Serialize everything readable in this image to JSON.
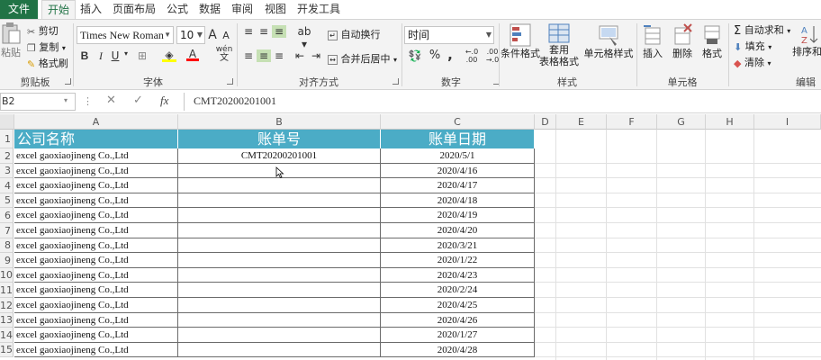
{
  "tabs": [
    "文件",
    "开始",
    "插入",
    "页面布局",
    "公式",
    "数据",
    "审阅",
    "视图",
    "开发工具"
  ],
  "clipboard": {
    "paste": "粘贴",
    "cut": "剪切",
    "copy": "复制",
    "format_painter": "格式刷",
    "label": "剪贴板"
  },
  "font": {
    "name": "Times New Roman",
    "size": "10",
    "label": "字体",
    "bold": "B",
    "italic": "I",
    "underline": "U",
    "grow": "A",
    "shrink": "A",
    "font_color": "A",
    "phonetic": "wén"
  },
  "alignment": {
    "wrap_text": "自动换行",
    "merge_center": "合并后居中",
    "label": "对齐方式"
  },
  "number": {
    "format": "时间",
    "percent": "%",
    "comma": ",",
    "label": "数字"
  },
  "styles": {
    "conditional": "条件格式",
    "table_l1": "套用",
    "table_l2": "表格格式",
    "cell_styles": "单元格样式",
    "label": "样式"
  },
  "cells": {
    "insert": "插入",
    "delete": "删除",
    "format": "格式",
    "label": "单元格"
  },
  "editing": {
    "autosum": "自动求和",
    "fill": "填充",
    "clear": "清除",
    "sort": "排序和",
    "label": "编辑"
  },
  "formula_bar": {
    "name_box": "B2",
    "fx": "fx",
    "value": "CMT20200201001"
  },
  "columns": [
    "A",
    "B",
    "C",
    "D",
    "E",
    "F",
    "G",
    "H",
    "I"
  ],
  "header_row": {
    "a": "公司名称",
    "b": "账单号",
    "c": "账单日期"
  },
  "rows": [
    {
      "num": "2",
      "company": "excel gaoxiaojineng Co.,Ltd",
      "bill_no": "CMT20200201001",
      "date": "2020/5/1"
    },
    {
      "num": "3",
      "company": "excel gaoxiaojineng Co.,Ltd",
      "bill_no": "",
      "date": "2020/4/16"
    },
    {
      "num": "4",
      "company": "excel gaoxiaojineng Co.,Ltd",
      "bill_no": "",
      "date": "2020/4/17"
    },
    {
      "num": "5",
      "company": "excel gaoxiaojineng Co.,Ltd",
      "bill_no": "",
      "date": "2020/4/18"
    },
    {
      "num": "6",
      "company": "excel gaoxiaojineng Co.,Ltd",
      "bill_no": "",
      "date": "2020/4/19"
    },
    {
      "num": "7",
      "company": "excel gaoxiaojineng Co.,Ltd",
      "bill_no": "",
      "date": "2020/4/20"
    },
    {
      "num": "8",
      "company": "excel gaoxiaojineng Co.,Ltd",
      "bill_no": "",
      "date": "2020/3/21"
    },
    {
      "num": "9",
      "company": "excel gaoxiaojineng Co.,Ltd",
      "bill_no": "",
      "date": "2020/1/22"
    },
    {
      "num": "10",
      "company": "excel gaoxiaojineng Co.,Ltd",
      "bill_no": "",
      "date": "2020/4/23"
    },
    {
      "num": "11",
      "company": "excel gaoxiaojineng Co.,Ltd",
      "bill_no": "",
      "date": "2020/2/24"
    },
    {
      "num": "12",
      "company": "excel gaoxiaojineng Co.,Ltd",
      "bill_no": "",
      "date": "2020/4/25"
    },
    {
      "num": "13",
      "company": "excel gaoxiaojineng Co.,Ltd",
      "bill_no": "",
      "date": "2020/4/26"
    },
    {
      "num": "14",
      "company": "excel gaoxiaojineng Co.,Ltd",
      "bill_no": "",
      "date": "2020/1/27"
    },
    {
      "num": "15",
      "company": "excel gaoxiaojineng Co.,Ltd",
      "bill_no": "",
      "date": "2020/4/28"
    }
  ],
  "first_row_num": "1",
  "colors": {
    "accent": "#217346",
    "header_fill": "#4bacc6",
    "header_text": "#ffffff"
  }
}
